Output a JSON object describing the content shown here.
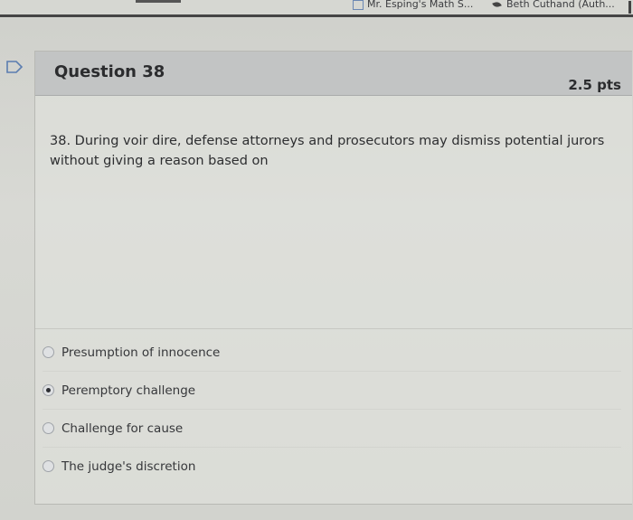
{
  "bookmarks": {
    "items": [
      {
        "label": "Mr. Esping's Math S...",
        "icon": "bookmark-page-icon"
      },
      {
        "label": "Beth Cuthand (Auth...",
        "icon": "leaf-icon"
      }
    ]
  },
  "question": {
    "title": "Question 38",
    "points": "2.5 pts",
    "text": "38. During voir dire, defense attorneys and prosecutors may dismiss potential jurors without giving a reason based on",
    "answers": [
      {
        "label": "Presumption of innocence",
        "selected": false
      },
      {
        "label": "Peremptory challenge",
        "selected": true
      },
      {
        "label": "Challenge for cause",
        "selected": false
      },
      {
        "label": "The judge's discretion",
        "selected": false
      }
    ]
  },
  "colors": {
    "header_bg": "#c2c4c4",
    "card_bg": "#e2e3de",
    "text": "#2d2e30",
    "flag_border": "#6b88b3"
  }
}
